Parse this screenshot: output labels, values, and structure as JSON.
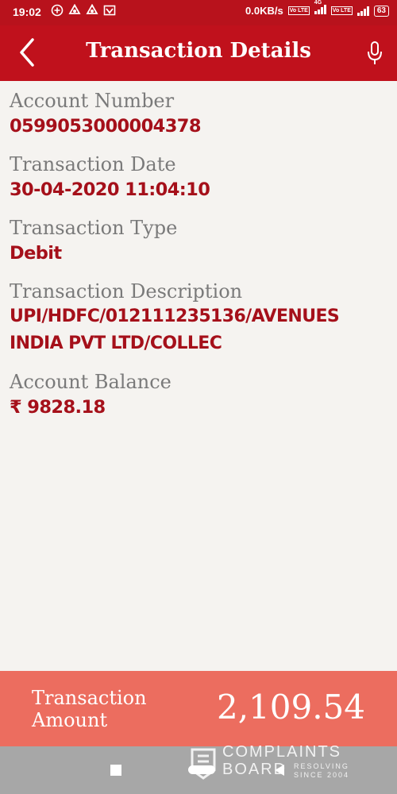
{
  "status_bar": {
    "time": "19:02",
    "net_speed": "0.0KB/s",
    "volte1": "Vo LTE",
    "network_type": "4G",
    "volte2": "Vo LTE",
    "battery": "63"
  },
  "header": {
    "title": "Transaction Details",
    "back_icon": "chevron-left-icon",
    "mic_icon": "microphone-icon"
  },
  "details": {
    "account_number_label": "Account Number",
    "account_number": "0599053000004378",
    "date_label": "Transaction Date",
    "date": "30-04-2020 11:04:10",
    "type_label": "Transaction Type",
    "type": "Debit",
    "description_label": "Transaction Description",
    "description_line1": "UPI/HDFC/012111235136/AVENUES",
    "description_line2": "INDIA PVT LTD/COLLEC",
    "balance_label": "Account Balance",
    "balance": "₹ 9828.18"
  },
  "amount": {
    "label": "Transaction Amount",
    "value": "2,109.54"
  },
  "watermark": {
    "line1": "COMPLAINTS",
    "line2": "BOARD",
    "tagline": "RESOLVING SINCE 2004"
  },
  "colors": {
    "header_bg": "#c0111c",
    "value_text": "#a5101a",
    "amount_bar": "#ec6d5f"
  }
}
